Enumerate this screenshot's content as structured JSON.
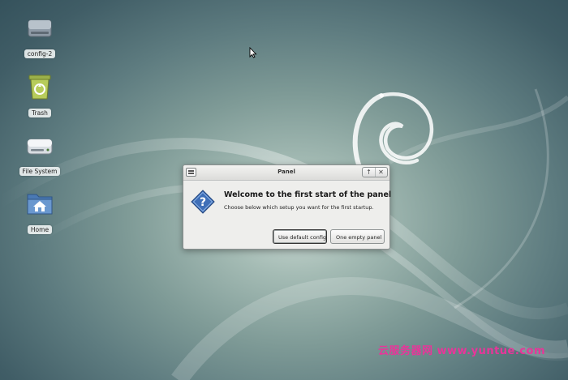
{
  "desktop": {
    "icons": [
      {
        "label": "config-2",
        "icon": "drive-icon"
      },
      {
        "label": "Trash",
        "icon": "trash-icon"
      },
      {
        "label": "File System",
        "icon": "drive-icon"
      },
      {
        "label": "Home",
        "icon": "home-folder-icon"
      }
    ]
  },
  "dialog": {
    "title": "Panel",
    "heading": "Welcome to the first start of the panel",
    "message": "Choose below which setup you want for the first startup.",
    "buttons": {
      "default_config": "Use default config",
      "empty_panel": "One empty panel"
    },
    "titlebar_buttons": {
      "maximize": "↑",
      "close": "✕"
    }
  },
  "watermark": "云服务器网 www.yuntue.com",
  "colors": {
    "watermark": "#e8359a",
    "dialog_bg": "#eeeeec",
    "question_icon": "#3f6fb8"
  }
}
